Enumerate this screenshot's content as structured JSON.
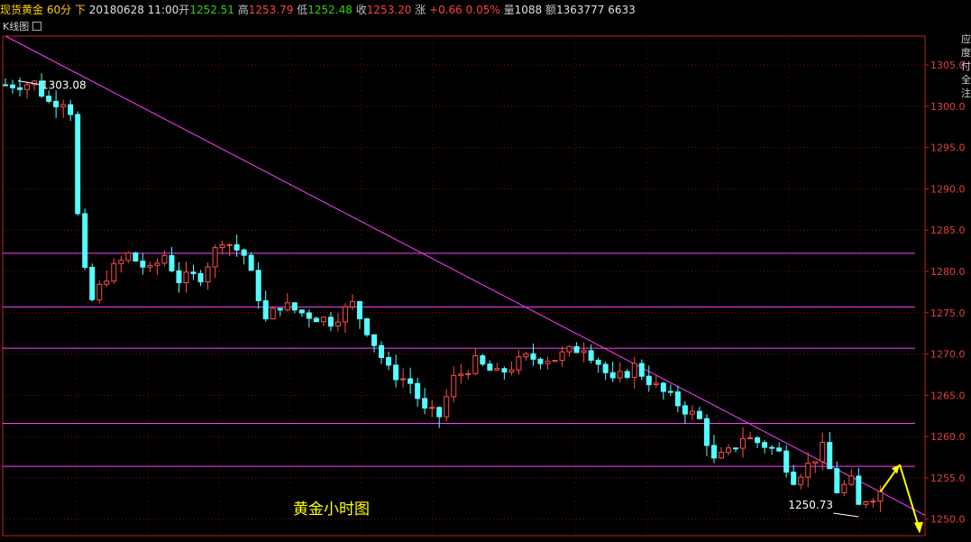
{
  "header": {
    "name": "现货黄金",
    "period": "60分",
    "direction": "下",
    "date": "20180628",
    "time": "11:00",
    "open_label": "开",
    "open_value": "1252.51",
    "high_label": "高",
    "high_value": "1253.79",
    "low_label": "低",
    "low_value": "1252.48",
    "close_label": "收",
    "close_value": "1253.20",
    "change_label": "涨",
    "change_value": "+0.66",
    "change_pct": "0.05%",
    "volume_label": "量",
    "volume_value": "1088",
    "amount_label": "额",
    "amount_value": "1363777",
    "extra_value": "6633"
  },
  "subbar": {
    "label": "K线图"
  },
  "right_strip": {
    "chars": [
      "应",
      "度",
      "付",
      "全",
      "注"
    ]
  },
  "colors": {
    "up": "#ff4d4d",
    "down": "#54ffff",
    "hline": "#ff40ff",
    "trendline": "#ff40ff",
    "axis": "#c02020",
    "arrow": "#ffff00",
    "caption": "#ffff00"
  },
  "chart_data": {
    "type": "candlestick",
    "ylim": [
      1248.0,
      1308.5
    ],
    "yticks": [
      1250.0,
      1255.0,
      1260.0,
      1265.0,
      1270.0,
      1275.0,
      1280.0,
      1285.0,
      1290.0,
      1295.0,
      1300.0,
      1305.0
    ],
    "horizontal_levels": [
      1282.2,
      1275.7,
      1270.7,
      1261.6,
      1256.4
    ],
    "trendline": {
      "start": {
        "index": 0,
        "value": 1308.5
      },
      "end": {
        "index": 119,
        "value": 1254.2
      }
    },
    "max_label": "1303.08",
    "min_label": "1250.73",
    "caption": "黄金小时图",
    "projection": {
      "up_to": 1256.6,
      "down_to": 1248.7
    },
    "anchors": [
      [
        0,
        1302.6
      ],
      [
        4,
        1302.8
      ],
      [
        6,
        1300.5
      ],
      [
        8,
        1300.8
      ],
      [
        9,
        1299.5
      ],
      [
        10,
        1287.0
      ],
      [
        11,
        1280.0
      ],
      [
        12,
        1276.5
      ],
      [
        14,
        1279.5
      ],
      [
        17,
        1282.0
      ],
      [
        20,
        1280.0
      ],
      [
        22,
        1282.0
      ],
      [
        24,
        1279.0
      ],
      [
        27,
        1279.5
      ],
      [
        30,
        1284.0
      ],
      [
        33,
        1282.0
      ],
      [
        35,
        1277.0
      ],
      [
        36,
        1274.0
      ],
      [
        38,
        1276.0
      ],
      [
        41,
        1275.0
      ],
      [
        45,
        1274.0
      ],
      [
        48,
        1276.0
      ],
      [
        50,
        1273.0
      ],
      [
        53,
        1268.0
      ],
      [
        56,
        1266.5
      ],
      [
        58,
        1263.0
      ],
      [
        60,
        1262.5
      ],
      [
        62,
        1267.0
      ],
      [
        65,
        1269.0
      ],
      [
        68,
        1267.5
      ],
      [
        72,
        1269.5
      ],
      [
        76,
        1269.5
      ],
      [
        80,
        1271.0
      ],
      [
        82,
        1269.0
      ],
      [
        84,
        1266.5
      ],
      [
        87,
        1268.5
      ],
      [
        90,
        1266.0
      ],
      [
        93,
        1264.0
      ],
      [
        96,
        1262.0
      ],
      [
        98,
        1257.0
      ],
      [
        100,
        1258.0
      ],
      [
        102,
        1260.0
      ],
      [
        105,
        1259.0
      ],
      [
        107,
        1258.0
      ],
      [
        109,
        1255.0
      ],
      [
        111,
        1256.5
      ],
      [
        113,
        1258.5
      ],
      [
        115,
        1253.5
      ],
      [
        117,
        1254.5
      ],
      [
        118,
        1251.5
      ],
      [
        119,
        1252.5
      ],
      [
        121,
        1253.3
      ]
    ]
  }
}
